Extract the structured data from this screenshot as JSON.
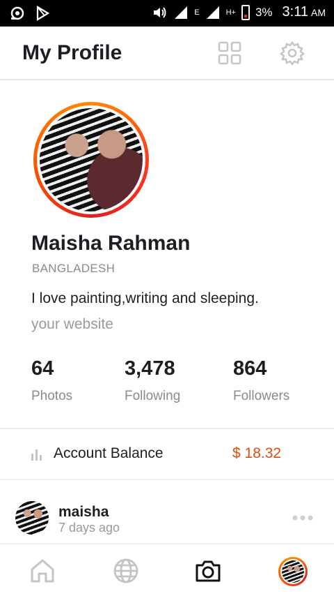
{
  "status_bar": {
    "network_label": "E",
    "data_label": "H+",
    "battery": "3%",
    "time": "3:11",
    "ampm": "AM"
  },
  "header": {
    "title": "My Profile",
    "grid_icon": "grid-view-icon",
    "settings_icon": "gear-icon"
  },
  "profile": {
    "name": "Maisha Rahman",
    "country": "BANGLADESH",
    "bio": "I love painting,writing and sleeping.",
    "website_placeholder": "your website",
    "ring_colors": [
      "#ff8a00",
      "#e02020"
    ]
  },
  "stats": [
    {
      "value": "64",
      "label": "Photos"
    },
    {
      "value": "3,478",
      "label": "Following"
    },
    {
      "value": "864",
      "label": "Followers"
    }
  ],
  "account": {
    "label": "Account Balance",
    "value": "$ 18.32",
    "value_color": "#e14a12"
  },
  "post": {
    "username": "maisha",
    "time": "7 days ago"
  },
  "bottom_nav": [
    "home-icon",
    "globe-icon",
    "camera-icon",
    "profile-avatar"
  ]
}
